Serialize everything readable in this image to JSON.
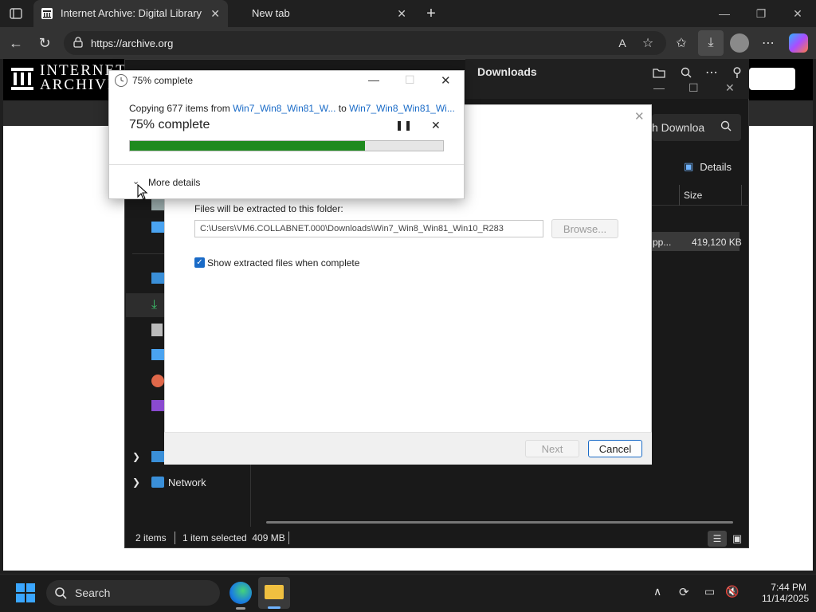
{
  "browser": {
    "tabs": [
      {
        "title": "Internet Archive: Digital Library of"
      },
      {
        "title": "New tab"
      }
    ],
    "address": "https://archive.org"
  },
  "site": {
    "logo_line1": "INTERNET",
    "logo_line2": "ARCHIVE"
  },
  "explorer": {
    "title": "Downloads",
    "search_placeholder": "h Downloa",
    "details_label": "Details",
    "column_size": "Size",
    "file_name_fragment": "pp...",
    "file_size": "419,120 KB",
    "nav_network": "Network",
    "status_items": "2 items",
    "status_selected": "1 item selected  409 MB"
  },
  "extract": {
    "folder_label": "Files will be extracted to this folder:",
    "folder_path": "C:\\Users\\VM6.COLLABNET.000\\Downloads\\Win7_Win8_Win81_Win10_R283",
    "browse_label": "Browse...",
    "show_files_label": "Show extracted files when complete",
    "next_label": "Next",
    "cancel_label": "Cancel"
  },
  "progress": {
    "title": "75% complete",
    "copy_prefix": "Copying 677 items from ",
    "copy_source": "Win7_Win8_Win81_W...",
    "copy_to": " to ",
    "copy_dest": "Win7_Win8_Win81_Wi...",
    "status": "75% complete",
    "percent": 75,
    "more_details": "More details",
    "bar_color": "#1e8a1e"
  },
  "taskbar": {
    "search_placeholder": "Search",
    "time": "7:44 PM",
    "date": "11/14/2025"
  }
}
